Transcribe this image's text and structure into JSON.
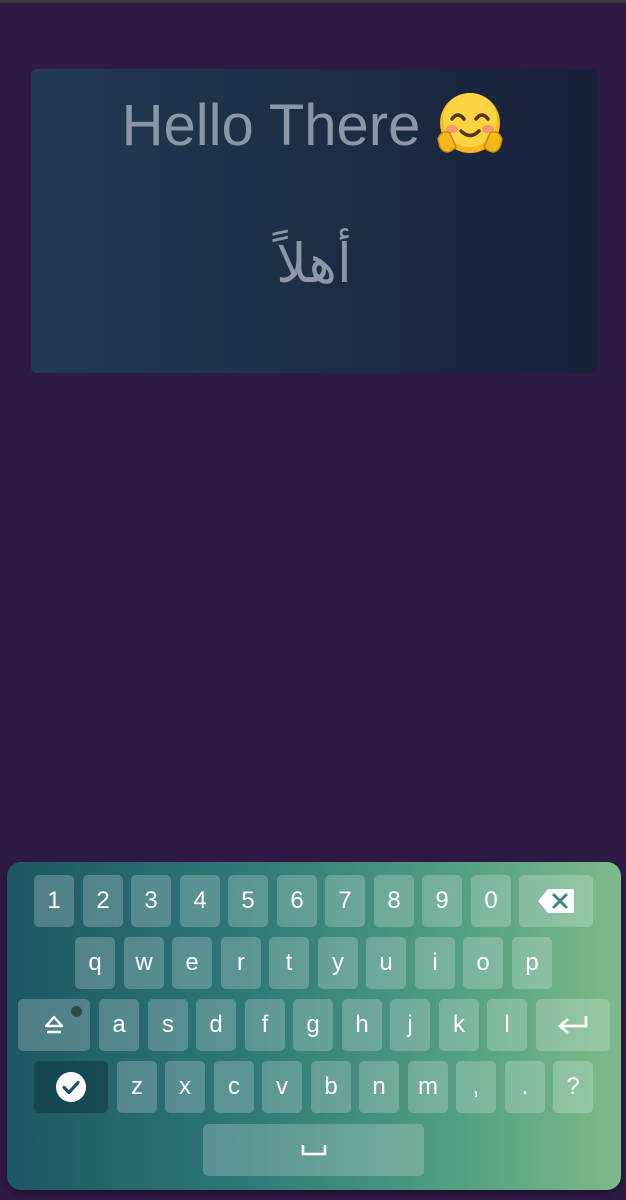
{
  "card": {
    "title": "Hello There",
    "subtitle": "أهلاً"
  },
  "keyboard": {
    "row_numbers": [
      "1",
      "2",
      "3",
      "4",
      "5",
      "6",
      "7",
      "8",
      "9",
      "0"
    ],
    "row_q": [
      "q",
      "w",
      "e",
      "r",
      "t",
      "y",
      "u",
      "i",
      "o",
      "p"
    ],
    "row_a": [
      "a",
      "s",
      "d",
      "f",
      "g",
      "h",
      "j",
      "k",
      "l"
    ],
    "row_z": [
      "z",
      "x",
      "c",
      "v",
      "b",
      "n",
      "m",
      ",",
      ".",
      "?"
    ],
    "icons": {
      "backspace": "backspace-icon",
      "shift": "shift-icon",
      "enter": "enter-icon",
      "done": "checkmark-icon",
      "space": "space-icon",
      "emoji": "hugging-face-icon"
    }
  },
  "colors": {
    "background": "#2f1a45",
    "card": "#1d2c45",
    "text": "#8c96a6"
  }
}
